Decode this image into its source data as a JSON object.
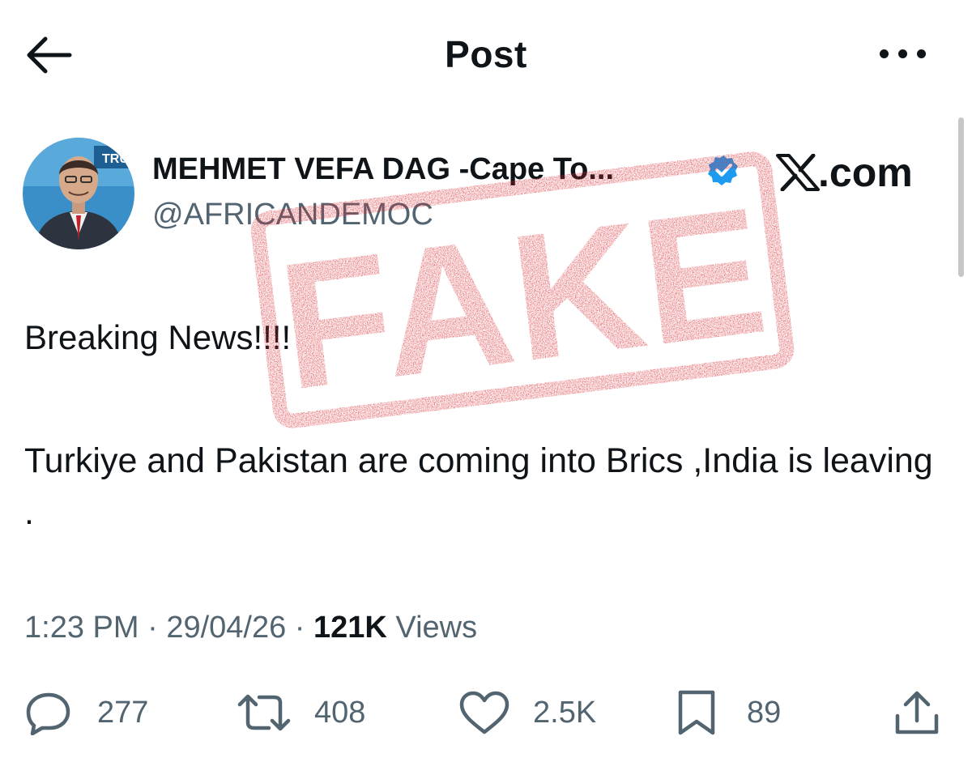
{
  "header": {
    "title": "Post"
  },
  "author": {
    "display_name": "MEHMET VEFA DAG -Cape To...",
    "handle": "@AFRICANDEMOC",
    "verified": true,
    "avatar_badge_text": "TRU"
  },
  "branding": {
    "site_suffix": ".com"
  },
  "tweet": {
    "line1": "Breaking News!!!!",
    "body": "Turkiye and Pakistan are coming into Brics ,India is leaving ."
  },
  "meta": {
    "time": "1:23 PM",
    "date": "29/04/26",
    "views_count": "121K",
    "views_label": "Views",
    "separator": "·"
  },
  "actions": {
    "replies": "277",
    "reposts": "408",
    "likes": "2.5K",
    "bookmarks": "89"
  },
  "stamp": {
    "text": "FAKE",
    "color": "#d7282f"
  },
  "colors": {
    "text_primary": "#0f1419",
    "text_secondary": "#536471",
    "verified_blue": "#1d9bf0",
    "background": "#ffffff"
  }
}
